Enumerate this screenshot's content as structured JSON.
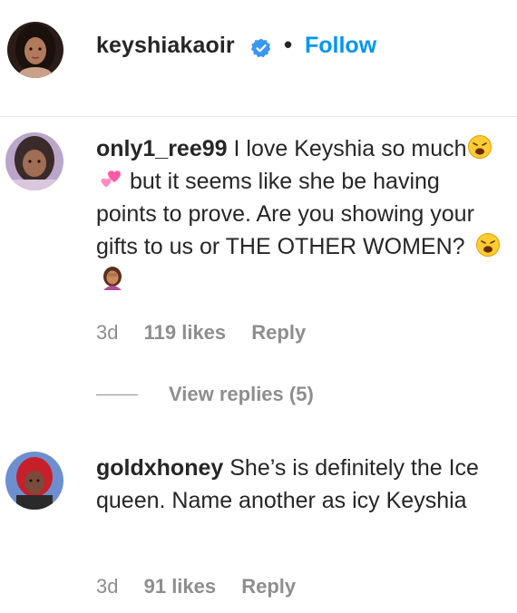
{
  "header": {
    "username": "keyshiakaoir",
    "separator": "•",
    "follow_label": "Follow"
  },
  "comments": [
    {
      "username": "only1_ree99",
      "text_parts": [
        "I love Keyshia so much",
        "but it seems like she be having points to prove. Are you showing your gifts to us or THE OTHER WOMEN?"
      ],
      "emojis": [
        "weary-face-emoji",
        "revolving-hearts-emoji",
        "weary-face-emoji",
        "woman-facepalming-emoji"
      ],
      "age": "3d",
      "likes": "119 likes",
      "reply_label": "Reply",
      "view_replies_label": "View replies (5)"
    },
    {
      "username": "goldxhoney",
      "text": "She’s is definitely the Ice queen. Name another as icy Keyshia",
      "age": "3d",
      "likes": "91 likes",
      "reply_label": "Reply"
    }
  ],
  "colors": {
    "link_blue": "#0095f6",
    "text": "#262626",
    "muted": "#8e8e8e",
    "verified_blue": "#3897f0",
    "divider": "#e6e6e6"
  }
}
